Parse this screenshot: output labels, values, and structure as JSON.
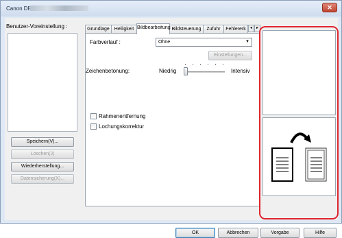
{
  "window": {
    "title": "Canon DR-",
    "close_glyph": "✕"
  },
  "user_presets": {
    "label": "Benutzer-Voreinstellung :",
    "buttons": [
      {
        "label": "Speichern(V)...",
        "enabled": true
      },
      {
        "label": "Löschen(J)",
        "enabled": false
      },
      {
        "label": "Wiederherstellung...",
        "enabled": true
      },
      {
        "label": "Datensicherung(X)...",
        "enabled": false
      }
    ]
  },
  "tabs": [
    {
      "label": "Grundlage",
      "active": false
    },
    {
      "label": "Helligkeit",
      "active": false
    },
    {
      "label": "Bildbearbeitung",
      "active": true
    },
    {
      "label": "Bildsteuerung",
      "active": false
    },
    {
      "label": "Zufuhr",
      "active": false
    },
    {
      "label": "Fehlererk",
      "active": false
    }
  ],
  "tab_scroll": {
    "left": "◂",
    "right": "▸"
  },
  "bildbearbeitung": {
    "farbverlauf_label": "Farbverlauf :",
    "farbverlauf_value": "Ohne",
    "einstellungen_label": "Einstellungen...",
    "zeichenbetonung_label": "Zeichenbetonung:",
    "slider_min_label": "Niedrig",
    "slider_max_label": "Intensiv",
    "slider_level": 0,
    "rahmenentfernung_label": "Rahmenentfernung",
    "rahmenentfernung_checked": false,
    "lochungskorrektur_label": "Lochungskorrektur",
    "lochungskorrektur_checked": false
  },
  "footer": {
    "ok_label": "OK",
    "abbrechen_label": "Abbrechen",
    "vorgabe_label": "Vorgabe",
    "hilfe_label": "Hilfe"
  },
  "colors": {
    "highlight_frame": "#e0242d",
    "titlebar": "#dbe6f4"
  },
  "icons": {
    "combo_arrow": "chevron-down-icon",
    "flip_arrow": "curved-arrow-icon"
  }
}
